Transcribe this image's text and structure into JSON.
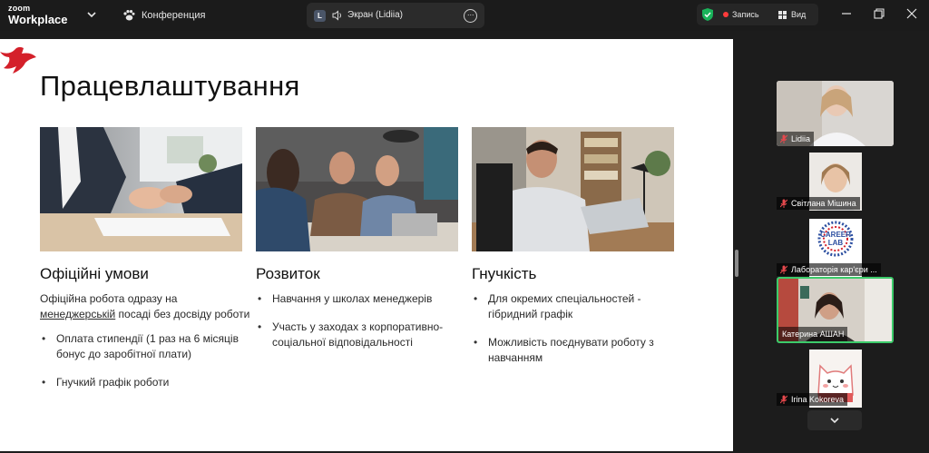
{
  "titlebar": {
    "brand_top": "zoom",
    "brand_bottom": "Workplace",
    "conference_label": "Конференция",
    "share_badge": "L",
    "share_label": "Экран (Lidiia)",
    "record_label": "Запись",
    "view_label": "Вид"
  },
  "slide": {
    "title": "Працевлаштування",
    "columns": [
      {
        "heading": "Офіційні умови",
        "intro_before": "Офіційна робота одразу на ",
        "intro_link": "менеджерській",
        "intro_after": " посаді без досвіду роботи",
        "bullets": [
          "Оплата стипендії (1 раз на 6 місяців бонус до заробітної плати)",
          "Гнучкий графік роботи"
        ]
      },
      {
        "heading": "Розвиток",
        "bullets": [
          "Навчання у школах менеджерів",
          "Участь у заходах з корпоративно-соціальної відповідальності"
        ]
      },
      {
        "heading": "Гнучкість",
        "bullets": [
          "Для окремих спеціальностей - гібридний графік",
          "Можливість поєднувати роботу з навчанням"
        ]
      }
    ]
  },
  "participants": [
    {
      "name": "Lidiia",
      "muted": true
    },
    {
      "name": "Світлана Мішина",
      "muted": true
    },
    {
      "name": "Лабораторія кар'єри ...",
      "muted": true,
      "logo_line1": "CAREER",
      "logo_line2": "LAB"
    },
    {
      "name": "Катерина АШАН",
      "muted": false,
      "active_speaker": true
    },
    {
      "name": "Irina Kokoreva",
      "muted": true
    }
  ],
  "colors": {
    "accent_green": "#3ccb6a",
    "record_red": "#ff3b3b",
    "shield_green": "#19b35a",
    "logo_red": "#d4202a",
    "mic_muted": "#e5484d"
  }
}
